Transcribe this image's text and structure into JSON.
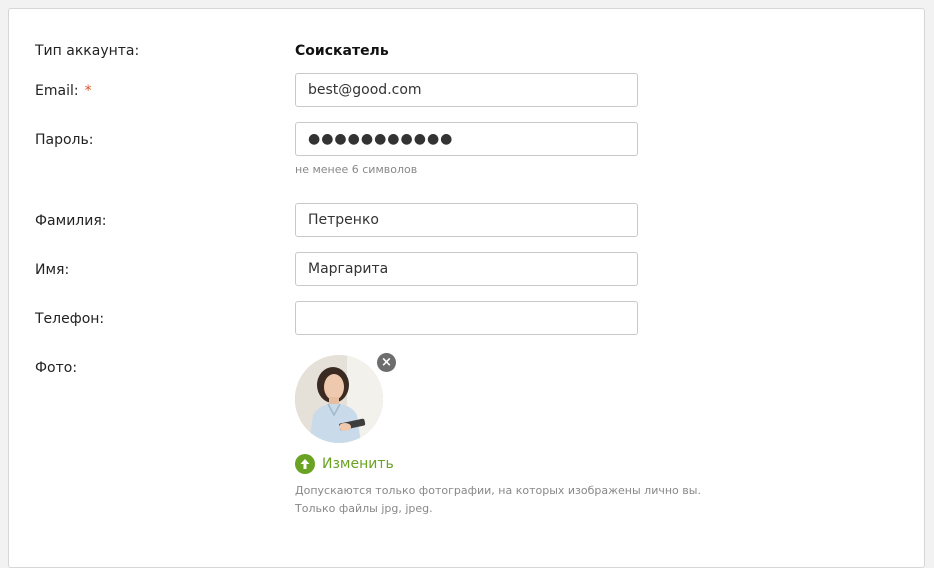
{
  "form": {
    "account_type": {
      "label": "Тип аккаунта:",
      "value": "Соискатель"
    },
    "email": {
      "label": "Email:",
      "required_mark": "*",
      "value": "best@good.com"
    },
    "password": {
      "label": "Пароль:",
      "value": "●●●●●●●●●●●",
      "hint": "не менее 6 символов"
    },
    "last_name": {
      "label": "Фамилия:",
      "value": "Петренко"
    },
    "first_name": {
      "label": "Имя:",
      "value": "Маргарита"
    },
    "phone": {
      "label": "Телефон:",
      "value": ""
    },
    "photo": {
      "label": "Фото:",
      "remove_icon": "close-icon",
      "change_label": "Изменить",
      "change_icon": "upload-arrow-icon",
      "hint_line1": "Допускаются только фотографии, на которых изображены лично вы.",
      "hint_line2": "Только файлы jpg, jpeg."
    }
  },
  "colors": {
    "accent_green": "#6aa323",
    "required_red": "#d9522c",
    "remove_gray": "#6d6d6d"
  }
}
